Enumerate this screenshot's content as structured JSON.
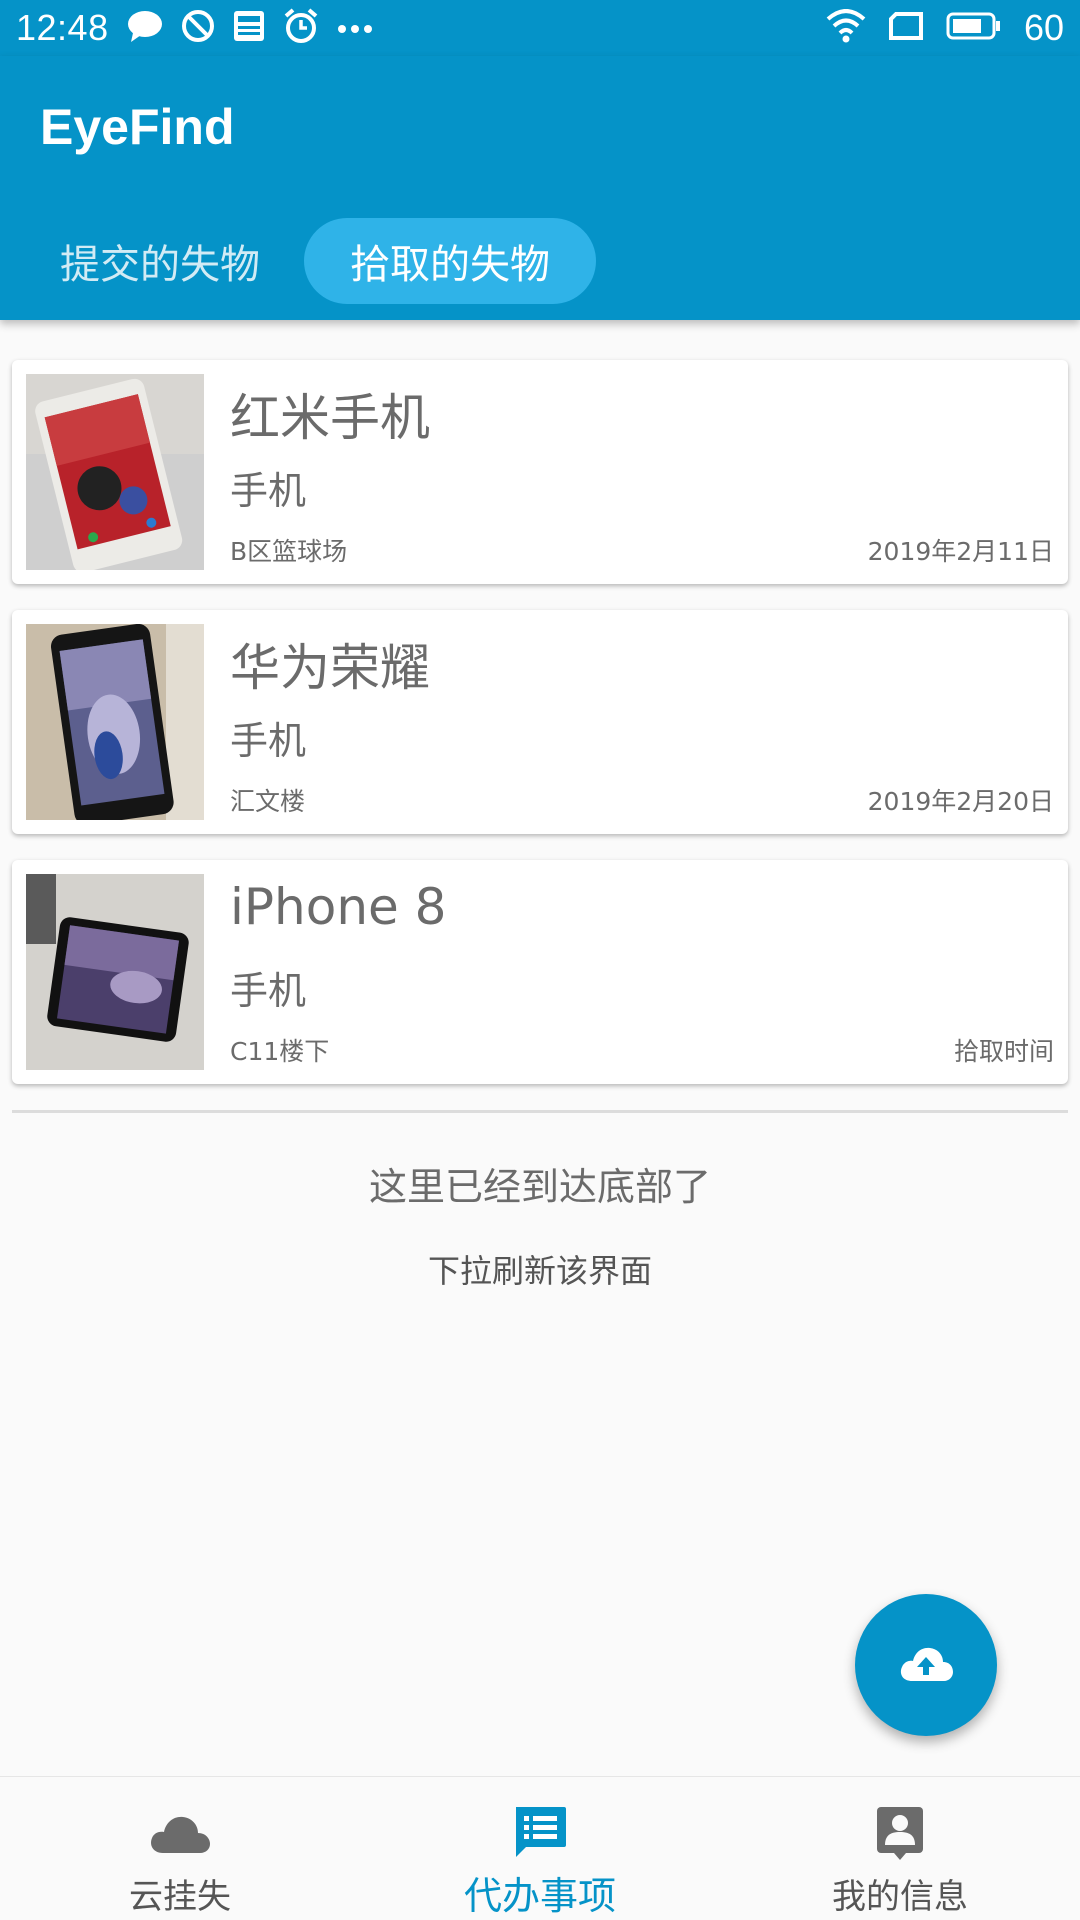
{
  "status_bar": {
    "time": "12:48",
    "battery": "60",
    "icons": [
      "message-icon",
      "do-not-disturb-icon",
      "news-icon",
      "alarm-icon",
      "more-icon",
      "wifi-icon",
      "sim-icon",
      "battery-icon"
    ]
  },
  "app_bar": {
    "title": "EyeFind",
    "tabs": [
      {
        "label": "提交的失物",
        "active": false
      },
      {
        "label": "拾取的失物",
        "active": true
      }
    ],
    "color": "#0593c8"
  },
  "items": [
    {
      "title": "红米手机",
      "category": "手机",
      "location": "B区篮球场",
      "date": "2019年2月11日",
      "image": "red-mi-phone-photo"
    },
    {
      "title": "华为荣耀",
      "category": "手机",
      "location": "汇文楼",
      "date": "2019年2月20日",
      "image": "huawei-honor-phone-photo"
    },
    {
      "title": "iPhone 8",
      "category": "手机",
      "location": "C11楼下",
      "date": "拾取时间",
      "image": "iphone-8-photo"
    }
  ],
  "list_footer": {
    "end_text": "这里已经到达底部了",
    "hint_text": "下拉刷新该界面"
  },
  "fab": {
    "icon": "cloud-upload-icon"
  },
  "bottom_nav": [
    {
      "label": "云挂失",
      "icon": "cloud-icon",
      "active": false
    },
    {
      "label": "代办事项",
      "icon": "todo-list-icon",
      "active": true
    },
    {
      "label": "我的信息",
      "icon": "profile-icon",
      "active": false
    }
  ]
}
